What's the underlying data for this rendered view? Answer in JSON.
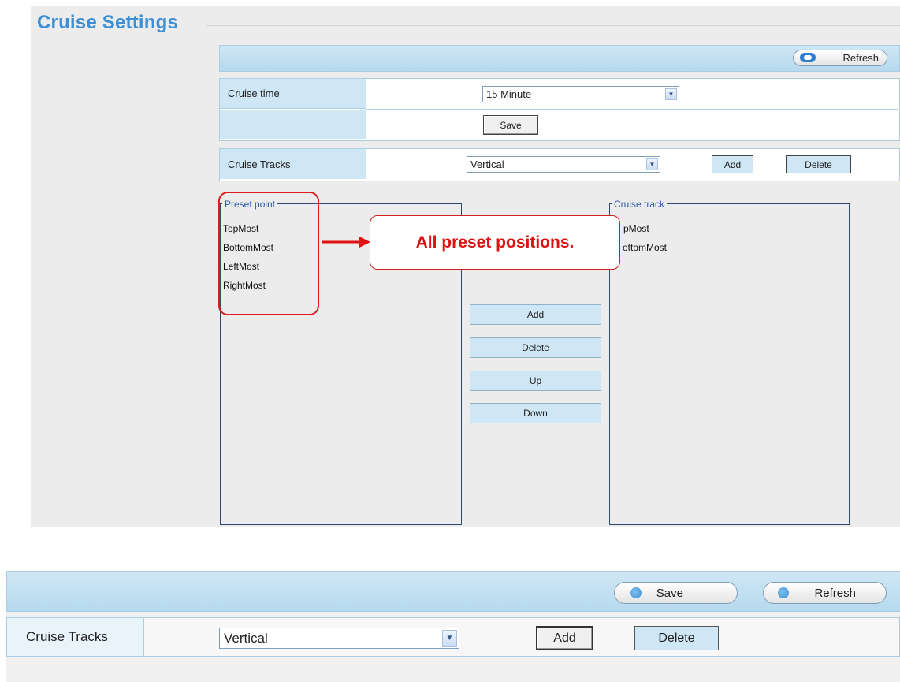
{
  "top": {
    "title": "Cruise Settings",
    "refresh_label": "Refresh",
    "cruise_time_label": "Cruise time",
    "cruise_time_value": "15 Minute",
    "save_label": "Save",
    "cruise_tracks_label": "Cruise Tracks",
    "cruise_tracks_value": "Vertical",
    "add_label": "Add",
    "delete_label": "Delete",
    "preset_point_legend": "Preset point",
    "preset_points": [
      "TopMost",
      "BottomMost",
      "LeftMost",
      "RightMost"
    ],
    "cruise_track_legend": "Cruise track",
    "cruise_track_items": [
      "pMost",
      "ottomMost"
    ],
    "middle_buttons": [
      "Add",
      "Delete",
      "Up",
      "Down"
    ],
    "callout_text": "All preset positions."
  },
  "bottom": {
    "save_label": "Save",
    "refresh_label": "Refresh",
    "cruise_tracks_label": "Cruise Tracks",
    "cruise_tracks_value": "Vertical",
    "add_label": "Add",
    "delete_label": "Delete"
  },
  "colors": {
    "title_blue": "#3d8fd6",
    "callout_red": "#e01010",
    "bar_blue": "#cfe7f5"
  }
}
